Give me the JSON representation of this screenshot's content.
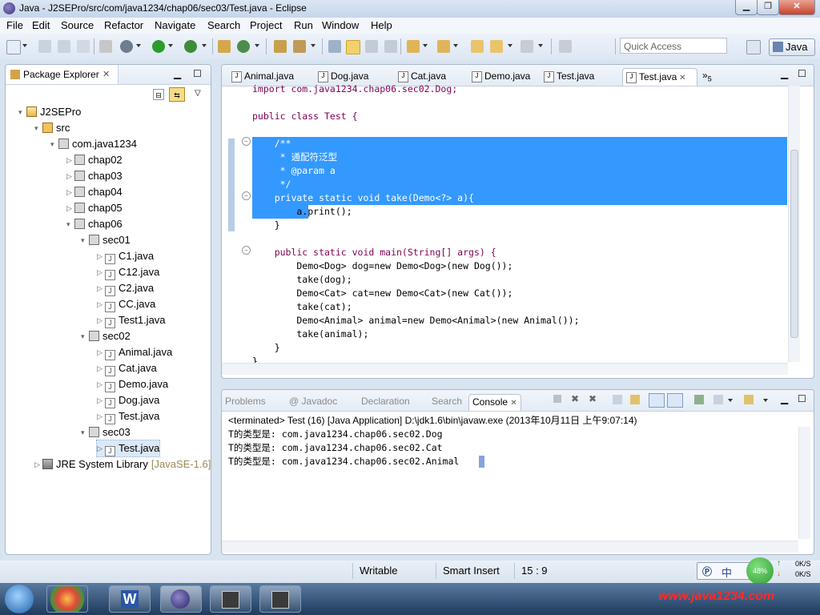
{
  "window": {
    "title": "Java - J2SEPro/src/com/java1234/chap06/sec03/Test.java - Eclipse"
  },
  "menu": [
    "File",
    "Edit",
    "Source",
    "Refactor",
    "Navigate",
    "Search",
    "Project",
    "Run",
    "Window",
    "Help"
  ],
  "toolbar": {
    "quick_access_placeholder": "Quick Access",
    "perspective": "Java"
  },
  "package_explorer": {
    "title": "Package Explorer",
    "tree": [
      {
        "label": "J2SEPro",
        "level": 0,
        "icon": "project-icon",
        "toggle": "▾"
      },
      {
        "label": "src",
        "level": 1,
        "icon": "source-folder-icon",
        "toggle": "▾"
      },
      {
        "label": "com.java1234",
        "level": 2,
        "icon": "package-icon",
        "toggle": "▾"
      },
      {
        "label": "chap02",
        "level": 3,
        "icon": "package-icon",
        "toggle": "▷"
      },
      {
        "label": "chap03",
        "level": 3,
        "icon": "package-icon",
        "toggle": "▷"
      },
      {
        "label": "chap04",
        "level": 3,
        "icon": "package-icon",
        "toggle": "▷"
      },
      {
        "label": "chap05",
        "level": 3,
        "icon": "package-icon",
        "toggle": "▷"
      },
      {
        "label": "chap06",
        "level": 3,
        "icon": "package-icon",
        "toggle": "▾"
      },
      {
        "label": "sec01",
        "level": 4,
        "icon": "package-icon",
        "toggle": "▾"
      },
      {
        "label": "C1.java",
        "level": 5,
        "icon": "java-file-icon",
        "toggle": "▷"
      },
      {
        "label": "C12.java",
        "level": 5,
        "icon": "java-file-icon",
        "toggle": "▷"
      },
      {
        "label": "C2.java",
        "level": 5,
        "icon": "java-file-icon",
        "toggle": "▷"
      },
      {
        "label": "CC.java",
        "level": 5,
        "icon": "java-file-icon",
        "toggle": "▷"
      },
      {
        "label": "Test1.java",
        "level": 5,
        "icon": "java-file-icon",
        "toggle": "▷"
      },
      {
        "label": "sec02",
        "level": 4,
        "icon": "package-icon",
        "toggle": "▾"
      },
      {
        "label": "Animal.java",
        "level": 5,
        "icon": "java-file-icon",
        "toggle": "▷"
      },
      {
        "label": "Cat.java",
        "level": 5,
        "icon": "java-file-icon",
        "toggle": "▷"
      },
      {
        "label": "Demo.java",
        "level": 5,
        "icon": "java-file-icon",
        "toggle": "▷"
      },
      {
        "label": "Dog.java",
        "level": 5,
        "icon": "java-file-icon",
        "toggle": "▷"
      },
      {
        "label": "Test.java",
        "level": 5,
        "icon": "java-file-icon",
        "toggle": "▷"
      },
      {
        "label": "sec03",
        "level": 4,
        "icon": "package-icon",
        "toggle": "▾"
      },
      {
        "label": "Test.java",
        "level": 5,
        "icon": "java-file-icon",
        "toggle": "▷",
        "selected": true
      },
      {
        "label": "JRE System Library",
        "level": 1,
        "icon": "library-icon",
        "toggle": "▷",
        "suffix": "[JavaSE-1.6]"
      }
    ]
  },
  "editor": {
    "tabs": [
      {
        "label": "Animal.java",
        "active": false
      },
      {
        "label": "Dog.java",
        "active": false
      },
      {
        "label": "Cat.java",
        "active": false
      },
      {
        "label": "Demo.java",
        "active": false
      },
      {
        "label": "Test.java",
        "active": false
      },
      {
        "label": "Test.java",
        "active": true
      }
    ],
    "overflow": "»",
    "overflow_count": "5",
    "code": [
      "import com.java1234.chap06.sec02.Dog;",
      "",
      "public class Test {",
      "",
      "    /**",
      "     * 通配符泛型",
      "     * @param a",
      "     */",
      "    private static void take(Demo<?> a){",
      "        a.print();",
      "    }",
      "",
      "    public static void main(String[] args) {",
      "        Demo<Dog> dog=new Demo<Dog>(new Dog());",
      "        take(dog);",
      "        Demo<Cat> cat=new Demo<Cat>(new Cat());",
      "        take(cat);",
      "        Demo<Animal> animal=new Demo<Animal>(new Animal());",
      "        take(animal);",
      "    }",
      "}"
    ]
  },
  "console": {
    "tabs": [
      "Problems",
      "@ Javadoc",
      "Declaration",
      "Search",
      "Console"
    ],
    "status": "<terminated> Test (16) [Java Application] D:\\jdk1.6\\bin\\javaw.exe (2013年10月11日 上午9:07:14)",
    "output": [
      "T的类型是: com.java1234.chap06.sec02.Dog",
      "T的类型是: com.java1234.chap06.sec02.Cat",
      "T的类型是: com.java1234.chap06.sec02.Animal"
    ]
  },
  "status_bar": {
    "writable": "Writable",
    "insert_mode": "Smart Insert",
    "position": "15 : 9",
    "ime": "中",
    "net_percent": "48%",
    "upload": "0K/S",
    "download": "0K/S"
  },
  "taskbar": {
    "watermark": "www.java1234.com"
  },
  "colors": {
    "selection": "#3399ff",
    "keyword": "#7f0055",
    "javadoc": "#3f5fbf"
  }
}
